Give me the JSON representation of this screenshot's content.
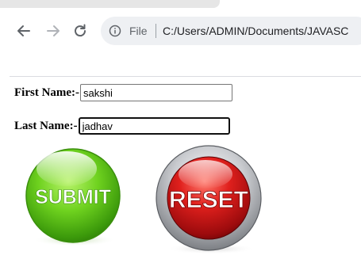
{
  "browser": {
    "nav": {
      "back_icon": "arrow-left-icon",
      "forward_icon": "arrow-right-icon",
      "reload_icon": "reload-icon"
    },
    "address_bar": {
      "info_icon": "info-circle-icon",
      "scheme_label": "File",
      "url": "C:/Users/ADMIN/Documents/JAVASC"
    }
  },
  "form": {
    "first_name": {
      "label": "First Name:-",
      "value": "sakshi"
    },
    "last_name": {
      "label": "Last Name:-",
      "value": "jadhav"
    },
    "submit_button": {
      "label": "SUBMIT",
      "color": "#5cc51a"
    },
    "reset_button": {
      "label": "RESET",
      "color": "#d9141b"
    }
  },
  "colors": {
    "accent_text": "#202124",
    "icon_gray": "#5f6368"
  }
}
